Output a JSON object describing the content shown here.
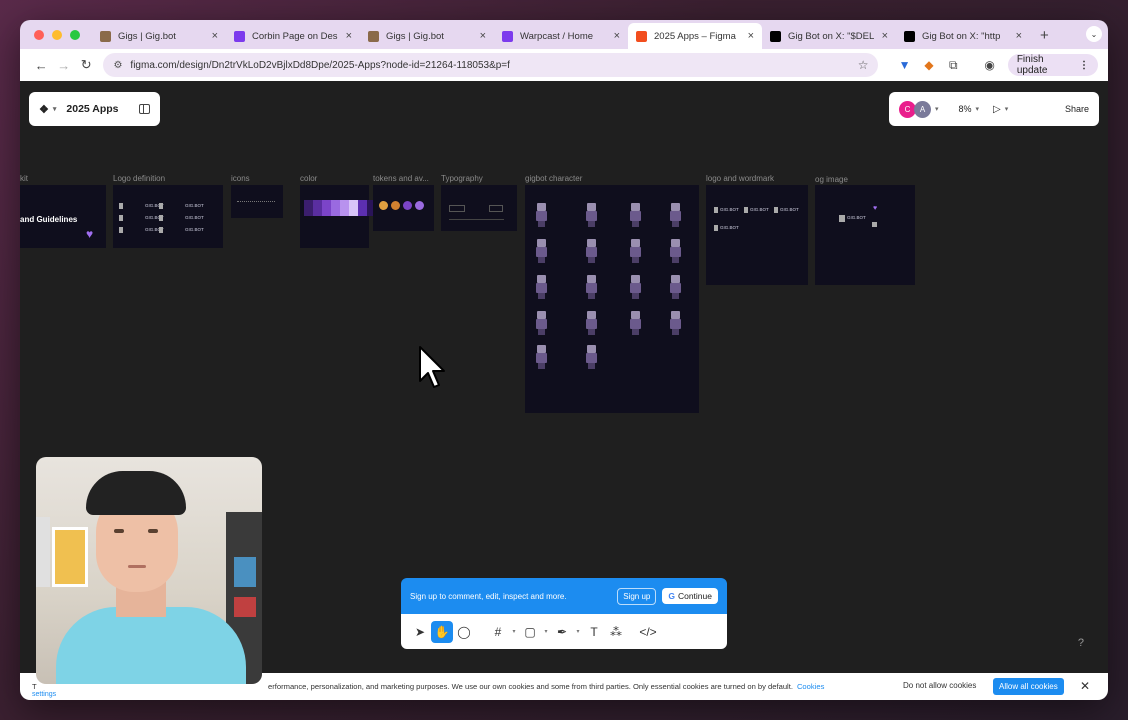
{
  "browser": {
    "tabs": [
      {
        "label": "Gigs | Gig.bot",
        "icon": "gigbot-icon",
        "color": "#8a6a4a",
        "active": false
      },
      {
        "label": "Corbin Page on Des",
        "icon": "warpcast-icon",
        "color": "#7c3aed",
        "active": false
      },
      {
        "label": "Gigs | Gig.bot",
        "icon": "gigbot-icon",
        "color": "#8a6a4a",
        "active": false
      },
      {
        "label": "Warpcast / Home",
        "icon": "warpcast-icon",
        "color": "#7c3aed",
        "active": false
      },
      {
        "label": "2025 Apps – Figma",
        "icon": "figma-icon",
        "color": "#f24e1e",
        "active": true
      },
      {
        "label": "Gig Bot on X: \"$DEL",
        "icon": "x-icon",
        "color": "#000000",
        "active": false
      },
      {
        "label": "Gig Bot on X: \"http",
        "icon": "x-icon",
        "color": "#000000",
        "active": false
      }
    ],
    "url": "figma.com/design/Dn2trVkLoD2vBjlxDd8Dpe/2025-Apps?node-id=21264-118053&p=f",
    "finish_update": "Finish update"
  },
  "figma": {
    "file_name": "2025 Apps",
    "avatars": [
      {
        "letter": "C",
        "color": "#e91e8c"
      },
      {
        "letter": "A",
        "color": "#7a7a9a"
      }
    ],
    "zoom": "8%",
    "share_label": "Share",
    "frames": [
      {
        "label": "kit",
        "title": "and Guidelines"
      },
      {
        "label": "Logo definition"
      },
      {
        "label": "icons"
      },
      {
        "label": "color"
      },
      {
        "label": "tokens and av..."
      },
      {
        "label": "Typography"
      },
      {
        "label": "gigbot character"
      },
      {
        "label": "logo and wordmark"
      },
      {
        "label": "og image"
      }
    ],
    "logo_samples": [
      "GIG.BOT",
      "GIG.BOT",
      "GIG.BOT",
      "GIG.BOT",
      "GIG.BOT",
      "GIG.BOT"
    ],
    "palette": [
      "#3b1e6e",
      "#5a2ea0",
      "#7b44c8",
      "#9a6ae0",
      "#b892ee",
      "#d8c4f8",
      "#5c2fb0",
      "#2a1458"
    ],
    "signup": {
      "text": "Sign up to comment, edit, inspect and more.",
      "signup_label": "Sign up",
      "continue_label": "Continue"
    },
    "help": "?"
  },
  "cookie": {
    "start_fragment": "T",
    "settings_fragment": "settings",
    "text": "erformance, personalization, and marketing purposes. We use our own cookies and some from third parties. Only essential cookies are turned on by default.",
    "link": "Cookies",
    "deny": "Do not allow cookies",
    "allow": "Allow all cookies"
  },
  "colors": {
    "accent": "#1c8cf0",
    "canvas": "#1f1f1f",
    "frame_bg": "#0f0e1d"
  }
}
